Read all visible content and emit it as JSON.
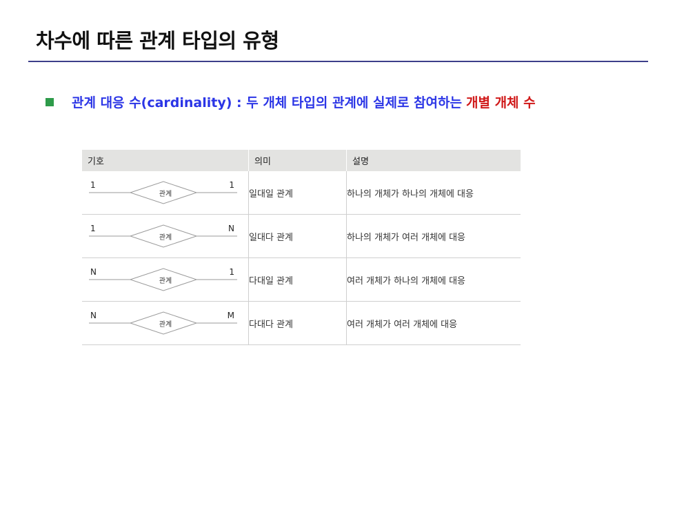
{
  "title": "차수에 따른 관계 타입의 유형",
  "bullet": {
    "main": "관계 대응 수(cardinality) : 두 개체 타입의 관계에 실제로 참여하는",
    "accent": "개별 개체 수"
  },
  "table": {
    "headers": [
      "기호",
      "의미",
      "설명"
    ],
    "rows": [
      {
        "left": "1",
        "right": "1",
        "rel": "관계",
        "meaning": "일대일 관계",
        "desc": "하나의 개체가 하나의 개체에 대응"
      },
      {
        "left": "1",
        "right": "N",
        "rel": "관계",
        "meaning": "일대다 관계",
        "desc": "하나의 개체가 여러 개체에 대응"
      },
      {
        "left": "N",
        "right": "1",
        "rel": "관계",
        "meaning": "다대일 관계",
        "desc": "여러 개체가 하나의 개체에 대응"
      },
      {
        "left": "N",
        "right": "M",
        "rel": "관계",
        "meaning": "다대다 관계",
        "desc": "여러 개체가 여러 개체에 대응"
      }
    ]
  },
  "colors": {
    "title_rule": "#3d3f8a",
    "bullet_square": "#2e9b4a",
    "bullet_text": "#2b35e6",
    "accent_text": "#d01818",
    "header_bg": "#e3e3e1"
  }
}
